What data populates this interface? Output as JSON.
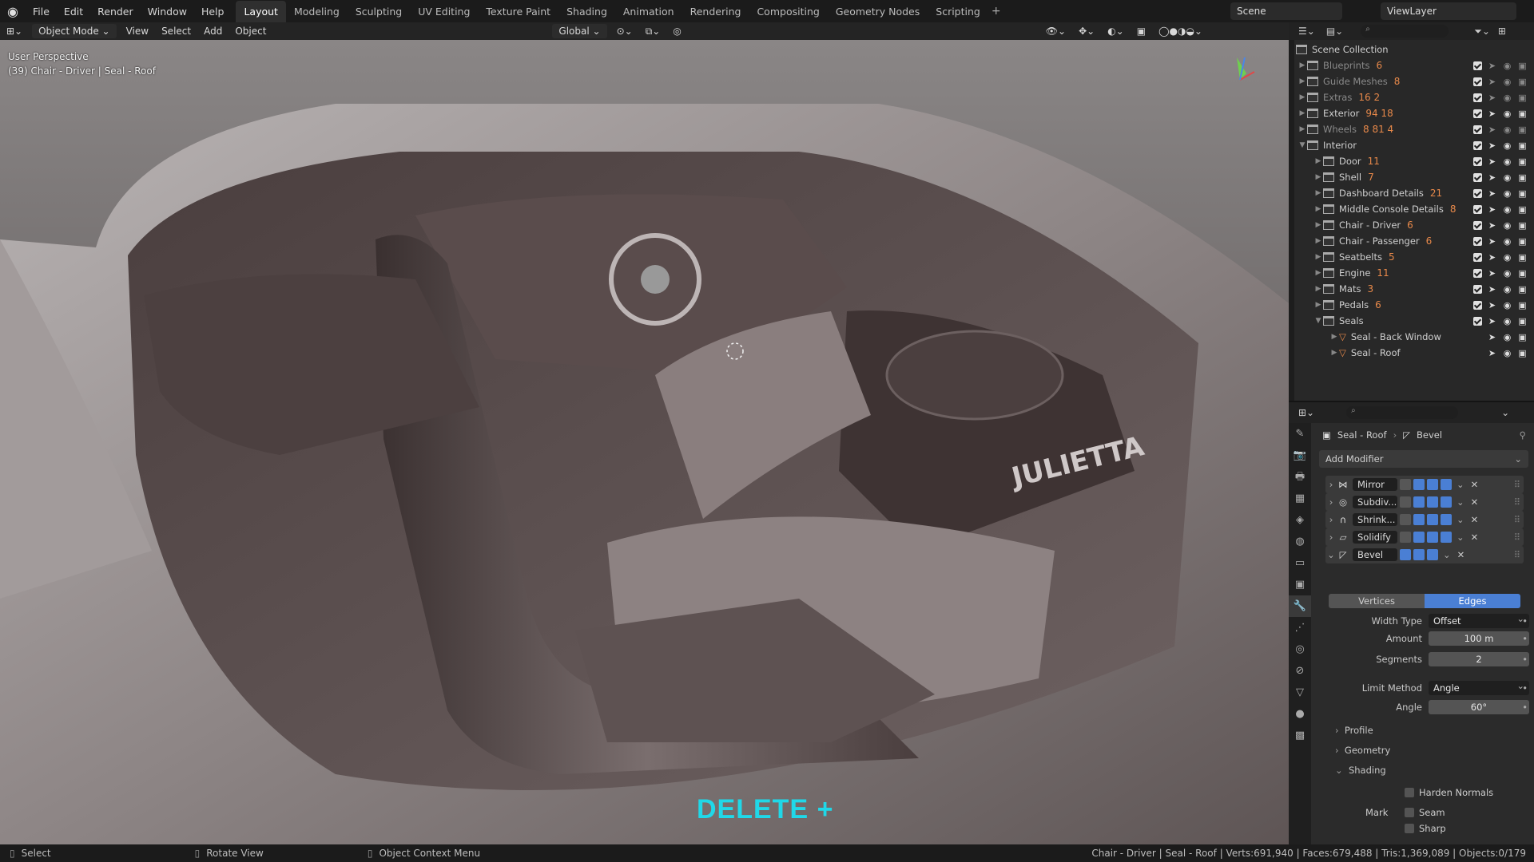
{
  "menu": [
    "File",
    "Edit",
    "Render",
    "Window",
    "Help"
  ],
  "workspaces": [
    {
      "label": "Layout",
      "active": true
    },
    {
      "label": "Modeling"
    },
    {
      "label": "Sculpting"
    },
    {
      "label": "UV Editing"
    },
    {
      "label": "Texture Paint"
    },
    {
      "label": "Shading"
    },
    {
      "label": "Animation"
    },
    {
      "label": "Rendering"
    },
    {
      "label": "Compositing"
    },
    {
      "label": "Geometry Nodes"
    },
    {
      "label": "Scripting"
    }
  ],
  "scene": "Scene",
  "view_layer": "ViewLayer",
  "toolbar": {
    "mode": "Object Mode",
    "view": "View",
    "select": "Select",
    "add": "Add",
    "object": "Object",
    "transform": "Global"
  },
  "viewport": {
    "perspective": "User Perspective",
    "active": "(39) Chair - Driver | Seal - Roof",
    "overlay": "DELETE +",
    "badge": "JULIETTA"
  },
  "outliner": {
    "root": "Scene Collection",
    "rows": [
      {
        "name": "Blueprints",
        "indent": 0,
        "dim": true,
        "count": "6"
      },
      {
        "name": "Guide Meshes",
        "indent": 0,
        "dim": true,
        "count": "8"
      },
      {
        "name": "Extras",
        "indent": 0,
        "dim": true,
        "count": "16  2"
      },
      {
        "name": "Exterior",
        "indent": 0,
        "count": "94  18"
      },
      {
        "name": "Wheels",
        "indent": 0,
        "dim": true,
        "count": "8  81  4"
      },
      {
        "name": "Interior",
        "indent": 0,
        "open": true,
        "count": ""
      },
      {
        "name": "Door",
        "indent": 1,
        "count": "11"
      },
      {
        "name": "Shell",
        "indent": 1,
        "count": "7"
      },
      {
        "name": "Dashboard Details",
        "indent": 1,
        "count": "21"
      },
      {
        "name": "Middle Console Details",
        "indent": 1,
        "count": "8"
      },
      {
        "name": "Chair - Driver",
        "indent": 1,
        "count": "6"
      },
      {
        "name": "Chair - Passenger",
        "indent": 1,
        "count": "6"
      },
      {
        "name": "Seatbelts",
        "indent": 1,
        "count": "5"
      },
      {
        "name": "Engine",
        "indent": 1,
        "count": "11"
      },
      {
        "name": "Mats",
        "indent": 1,
        "count": "3"
      },
      {
        "name": "Pedals",
        "indent": 1,
        "count": "6"
      },
      {
        "name": "Seals",
        "indent": 1,
        "open": true,
        "count": ""
      },
      {
        "name": "Seal - Back Window",
        "indent": 2,
        "count": ""
      },
      {
        "name": "Seal - Roof",
        "indent": 2,
        "count": ""
      }
    ]
  },
  "properties": {
    "breadcrumb_object": "Seal - Roof",
    "breadcrumb_modifier": "Bevel",
    "add_modifier": "Add Modifier",
    "modifiers": [
      "Mirror",
      "Subdiv...",
      "Shrink...",
      "Solidify",
      "Bevel"
    ],
    "tabs": [
      "Vertices",
      "Edges"
    ],
    "width_type_label": "Width Type",
    "width_type": "Offset",
    "amount_label": "Amount",
    "amount": "100 m",
    "segments_label": "Segments",
    "segments": "2",
    "limit_method_label": "Limit Method",
    "limit_method": "Angle",
    "angle_label": "Angle",
    "angle": "60°",
    "profile": "Profile",
    "geometry": "Geometry",
    "shading": "Shading",
    "harden_normals": "Harden Normals",
    "mark": "Mark",
    "seam": "Seam",
    "sharp": "Sharp"
  },
  "status": {
    "select": "Select",
    "rotate": "Rotate View",
    "context": "Object Context Menu",
    "stats": "Chair - Driver | Seal - Roof | Verts:691,940 | Faces:679,488 | Tris:1,369,089 | Objects:0/179"
  }
}
